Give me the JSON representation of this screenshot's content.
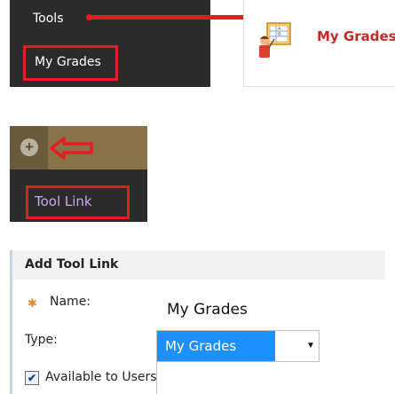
{
  "course_menu": {
    "items": [
      {
        "label": "Tools"
      },
      {
        "label": "My Grades"
      }
    ]
  },
  "preview": {
    "title": "My Grades",
    "icon": "grades-chart-icon"
  },
  "add_menu": {
    "add_icon": "plus-circle-icon",
    "pointer_icon": "red-arrow-icon",
    "option_label": "Tool Link"
  },
  "form": {
    "title": "Add Tool Link",
    "name_label": "Name:",
    "name_value": "My Grades",
    "type_label": "Type:",
    "type_value": "My Grades",
    "available_label": "Available to Users",
    "available_checked": true
  },
  "colors": {
    "highlight": "#e51c23",
    "menu_bg": "#2b2b2b",
    "add_bar": "#8a7248",
    "select_highlight": "#1e90ff",
    "preview_title": "#c62828",
    "tool_link_text": "#c9a9e8"
  }
}
